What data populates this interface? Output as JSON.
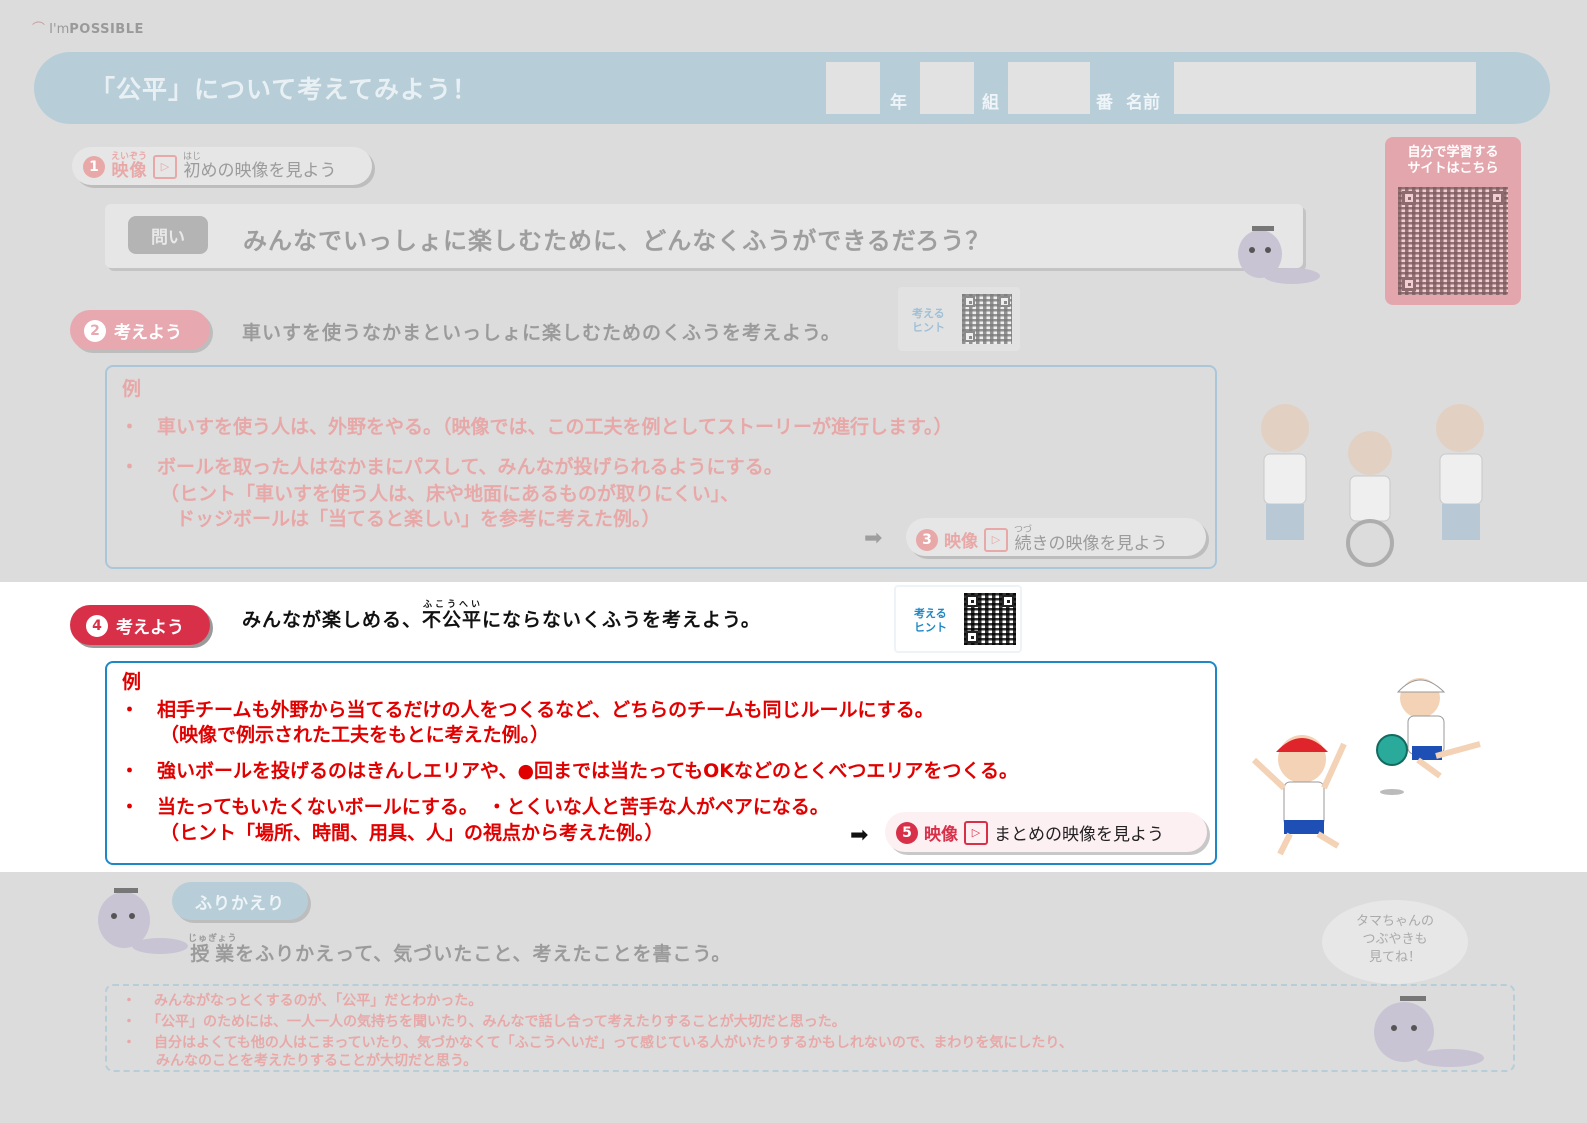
{
  "logo": {
    "prefix": "I'm",
    "suffix": "POSSIBLE"
  },
  "header": {
    "title": "「公平」について考えてみよう！",
    "grade_label": "年",
    "class_label": "組",
    "number_label": "番",
    "name_label": "名前"
  },
  "self_study": {
    "line1": "自分で学習する",
    "line2": "サイトはこちら"
  },
  "step1": {
    "num": "1",
    "tag_ruby": "えいぞう",
    "tag": "映像",
    "label_ruby": "はじ",
    "label_first": "初",
    "label_rest": "めの映像を見よう"
  },
  "question": {
    "badge": "問い",
    "text": "みんなでいっしょに楽しむために、どんなくふうができるだろう？"
  },
  "step2": {
    "num": "2",
    "tag": "考えよう",
    "text": "車いすを使うなかまといっしょに楽しむためのくふうを考えよう。"
  },
  "hint": {
    "line1": "考える",
    "line2": "ヒント"
  },
  "example2": {
    "label": "例",
    "bullet": "・",
    "items": [
      "車いすを使う人は、外野をやる。（映像では、この工夫を例としてストーリーが進行します。）",
      "ボールを取った人はなかまにパスして、みんなが投げられるようにする。",
      "（ヒント「車いすを使う人は、床や地面にあるものが取りにくい」、",
      "ドッジボールは「当てると楽しい」を参考に考えた例。）"
    ]
  },
  "step3": {
    "arrow": "➡",
    "num": "3",
    "tag": "映像",
    "label_ruby": "つづ",
    "label_first": "続",
    "label_rest": "きの映像を見よう"
  },
  "step4": {
    "num": "4",
    "tag": "考えよう",
    "text_pre": "みんなが楽しめる、",
    "text_ruby_base": "不公平",
    "text_ruby": "ふこうへい",
    "text_post": "にならないくふうを考えよう。"
  },
  "example4": {
    "label": "例",
    "bullet": "・",
    "items": [
      "相手チームも外野から当てるだけの人をつくるなど、どちらのチームも同じルールにする。",
      "（映像で例示された工夫をもとに考えた例。）",
      "強いボールを投げるのはきんしエリアや、●回までは当たってもOKなどのとくべつエリアをつくる。",
      "当たってもいたくないボールにする。　・とくいな人と苦手な人がペアになる。",
      "（ヒント「場所、時間、用具、人」の視点から考えた例。）"
    ]
  },
  "step5": {
    "arrow": "➡",
    "num": "5",
    "tag": "映像",
    "label": "まとめの映像を見よう"
  },
  "reflection": {
    "badge": "ふりかえり",
    "prompt_ruby": "じゅぎょう",
    "prompt_base": "授業",
    "prompt_rest": "をふりかえって、気づいたこと、考えたことを書こう。",
    "bullet": "・",
    "items": [
      "みんながなっとくするのが、「公平」だとわかった。",
      "「公平」のためには、一人一人の気持ちを聞いたり、みんなで話し合って考えたりすることが大切だと思った。",
      "自分はよくても他の人はこまっていたり、気づかなくて「ふこうへいだ」って感じている人がいたりするかもしれないので、まわりを気にしたり、",
      "みんなのことを考えたりすることが大切だと思う。"
    ]
  },
  "bubble": {
    "line1": "タマちゃんの",
    "line2": "つぶやきも",
    "line3": "見てね！"
  },
  "colors": {
    "accent_red": "#e00000",
    "accent_blue": "#1e88c7",
    "step_pink": "#d9304a"
  }
}
